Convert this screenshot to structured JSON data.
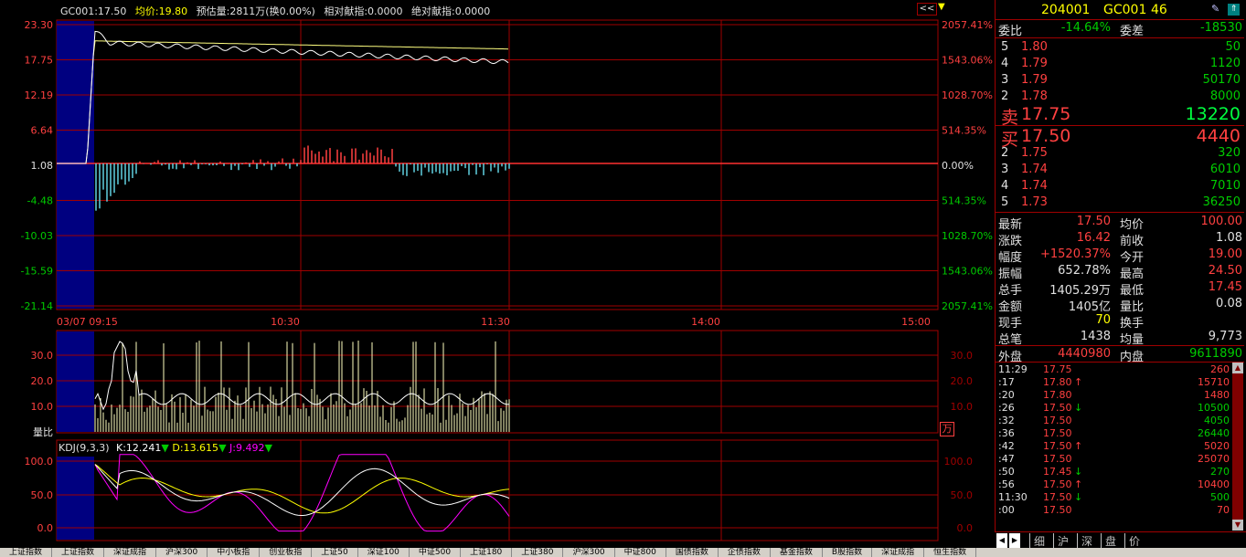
{
  "header": {
    "code_price": "GC001:17.50",
    "avg_price": "均价:19.80",
    "est_volume": "预估量:2811万(换0.00%)",
    "rel_contrib": "相对献指:0.0000",
    "abs_contrib": "绝对献指:0.0000",
    "collapse_btn": "<<"
  },
  "price_axis_left": [
    "23.30",
    "17.75",
    "12.19",
    "6.64",
    "1.08",
    "-4.48",
    "-10.03",
    "-15.59",
    "-21.14"
  ],
  "price_axis_right": [
    "2057.41%",
    "1543.06%",
    "1028.70%",
    "514.35%",
    "0.00%",
    "514.35%",
    "1028.70%",
    "1543.06%",
    "2057.41%"
  ],
  "time_axis": [
    "03/07 09:15",
    "10:30",
    "11:30",
    "14:00",
    "15:00"
  ],
  "volume_panel": {
    "axis_left": [
      "30.0",
      "20.0",
      "10.0"
    ],
    "axis_right": [
      "30.0",
      "20.0",
      "10.0"
    ],
    "label": "量比",
    "unit_badge": "万"
  },
  "kdj_panel": {
    "title": "KDJ(9,3,3)",
    "k": "K:12.241",
    "d": "D:13.615",
    "j": "J:9.492",
    "axis_left": [
      "100.0",
      "50.0",
      "0.0"
    ],
    "axis_right": [
      "100.0",
      "50.0",
      "0.0"
    ]
  },
  "quote": {
    "code": "204001",
    "name": "GC001",
    "number": "46",
    "webi_label": "委比",
    "webi_value": "-14.64%",
    "weicha_label": "委差",
    "weicha_value": "-18530",
    "sells": [
      {
        "level": "5",
        "price": "1.80",
        "vol": "50"
      },
      {
        "level": "4",
        "price": "1.79",
        "vol": "1120"
      },
      {
        "level": "3",
        "price": "1.79",
        "vol": "50170"
      },
      {
        "level": "2",
        "price": "1.78",
        "vol": "8000"
      },
      {
        "level": "卖",
        "price": "17.75",
        "vol": "13220"
      }
    ],
    "buys": [
      {
        "level": "买",
        "price": "17.50",
        "vol": "4440"
      },
      {
        "level": "2",
        "price": "1.75",
        "vol": "320"
      },
      {
        "level": "3",
        "price": "1.74",
        "vol": "6010"
      },
      {
        "level": "4",
        "price": "1.74",
        "vol": "7010"
      },
      {
        "level": "5",
        "price": "1.73",
        "vol": "36250"
      }
    ],
    "stats": [
      {
        "l1": "最新",
        "v1": "17.50",
        "c1": "#ff4040",
        "l2": "均价",
        "v2": "100.00",
        "c2": "#ff4040"
      },
      {
        "l1": "涨跌",
        "v1": "16.42",
        "c1": "#ff4040",
        "l2": "前收",
        "v2": "1.08",
        "c2": "#e0e0e0"
      },
      {
        "l1": "幅度",
        "v1": "+1520.37%",
        "c1": "#ff4040",
        "l2": "今开",
        "v2": "19.00",
        "c2": "#ff4040"
      },
      {
        "l1": "振幅",
        "v1": "652.78%",
        "c1": "#e0e0e0",
        "l2": "最高",
        "v2": "24.50",
        "c2": "#ff4040"
      },
      {
        "l1": "总手",
        "v1": "1405.29万",
        "c1": "#e0e0e0",
        "l2": "最低",
        "v2": "17.45",
        "c2": "#ff4040"
      },
      {
        "l1": "金额",
        "v1": "1405亿",
        "c1": "#e0e0e0",
        "l2": "量比",
        "v2": "0.08",
        "c2": "#e0e0e0"
      },
      {
        "l1": "现手",
        "v1": "70",
        "c1": "#ffff00",
        "l2": "换手",
        "v2": "",
        "c2": "#e0e0e0"
      },
      {
        "l1": "总笔",
        "v1": "1438",
        "c1": "#e0e0e0",
        "l2": "均量",
        "v2": "9,773",
        "c2": "#e0e0e0"
      }
    ],
    "outer_label": "外盘",
    "outer_value": "4440980",
    "inner_label": "内盘",
    "inner_value": "9611890"
  },
  "ticks": [
    {
      "t": "11:29",
      "p": "17.75",
      "a": "",
      "v": "260",
      "c": "#ff4040"
    },
    {
      "t": ":17",
      "p": "17.80",
      "a": "↑",
      "v": "15710",
      "c": "#ff4040"
    },
    {
      "t": ":20",
      "p": "17.80",
      "a": "",
      "v": "1480",
      "c": "#ff4040"
    },
    {
      "t": ":26",
      "p": "17.50",
      "a": "↓",
      "v": "10500",
      "c": "#00cc00"
    },
    {
      "t": ":32",
      "p": "17.50",
      "a": "",
      "v": "4050",
      "c": "#00cc00"
    },
    {
      "t": ":36",
      "p": "17.50",
      "a": "",
      "v": "26440",
      "c": "#00cc00"
    },
    {
      "t": ":42",
      "p": "17.50",
      "a": "↑",
      "v": "5020",
      "c": "#ff4040"
    },
    {
      "t": ":47",
      "p": "17.50",
      "a": "",
      "v": "25070",
      "c": "#ff4040"
    },
    {
      "t": ":50",
      "p": "17.45",
      "a": "↓",
      "v": "270",
      "c": "#00cc00"
    },
    {
      "t": ":56",
      "p": "17.50",
      "a": "↑",
      "v": "10400",
      "c": "#ff4040"
    },
    {
      "t": "11:30",
      "p": "17.50",
      "a": "↓",
      "v": "500",
      "c": "#00cc00"
    },
    {
      "t": ":00",
      "p": "17.50",
      "a": "",
      "v": "70",
      "c": "#ff4040"
    }
  ],
  "tabs": [
    "细",
    "沪",
    "深",
    "盘",
    "价"
  ],
  "bottom_tabs": [
    "上证指数",
    "上证指数",
    "深证成指",
    "沪深300",
    "中小板指",
    "创业板指",
    "上证50",
    "深证100",
    "中证500",
    "上证180",
    "上证380",
    "沪深300",
    "中证800",
    "国债指数",
    "企债指数",
    "基金指数",
    "B股指数",
    "深证成指",
    "恒生指数"
  ],
  "colors": {
    "up": "#ff4040",
    "down": "#00cc00",
    "grid": "#a00000",
    "accent": "#ffff00",
    "vol_bar": "#ffffc0"
  }
}
